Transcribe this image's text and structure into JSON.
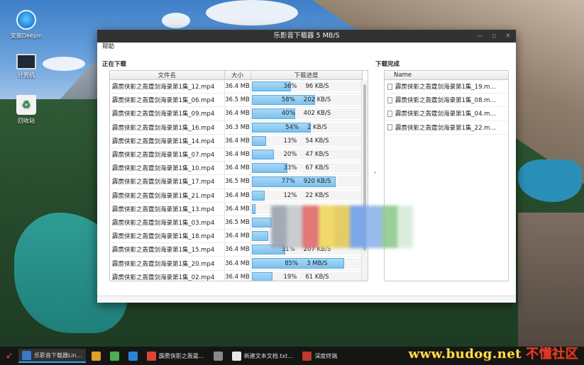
{
  "desktop": {
    "icons": [
      {
        "label": "安装Deepin"
      },
      {
        "label": "计算机"
      },
      {
        "label": "回收站"
      }
    ]
  },
  "window": {
    "title": "乐影音下载器  5 MB/S",
    "menu": {
      "help": "帮助"
    },
    "downloading": {
      "title": "正在下载",
      "columns": [
        "文件名",
        "大小",
        "下载进度"
      ],
      "rows": [
        {
          "name": "霹雳侠影之轰霆剑海录第1集_12.mp4",
          "size": "36.4 MB",
          "percent": "36%",
          "speed": "96 KB/S",
          "progress": 0.36
        },
        {
          "name": "霹雳侠影之轰霆剑海录第1集_06.mp4",
          "size": "36.5 MB",
          "percent": "58%",
          "speed": "202 KB/S",
          "progress": 0.58
        },
        {
          "name": "霹雳侠影之轰霆剑海录第1集_09.mp4",
          "size": "36.4 MB",
          "percent": "40%",
          "speed": "402 KB/S",
          "progress": 0.4
        },
        {
          "name": "霹雳侠影之轰霆剑海录第1集_16.mp4",
          "size": "36.3 MB",
          "percent": "54%",
          "speed": "2 KB/S",
          "progress": 0.54
        },
        {
          "name": "霹雳侠影之轰霆剑海录第1集_14.mp4",
          "size": "36.4 MB",
          "percent": "13%",
          "speed": "54 KB/S",
          "progress": 0.13
        },
        {
          "name": "霹雳侠影之轰霆剑海录第1集_07.mp4",
          "size": "36.4 MB",
          "percent": "20%",
          "speed": "47 KB/S",
          "progress": 0.2
        },
        {
          "name": "霹雳侠影之轰霆剑海录第1集_10.mp4",
          "size": "36.4 MB",
          "percent": "33%",
          "speed": "67 KB/S",
          "progress": 0.33
        },
        {
          "name": "霹雳侠影之轰霆剑海录第1集_17.mp4",
          "size": "36.5 MB",
          "percent": "77%",
          "speed": "920 KB/S",
          "progress": 0.77
        },
        {
          "name": "霹雳侠影之轰霆剑海录第1集_21.mp4",
          "size": "36.4 MB",
          "percent": "12%",
          "speed": "22 KB/S",
          "progress": 0.12
        },
        {
          "name": "霹雳侠影之轰霆剑海录第1集_13.mp4",
          "size": "36.4 MB",
          "percent": "",
          "speed": "",
          "progress": 0.03
        },
        {
          "name": "霹雳侠影之轰霆剑海录第1集_03.mp4",
          "size": "36.5 MB",
          "percent": "",
          "speed": "",
          "progress": 0.18
        },
        {
          "name": "霹雳侠影之轰霆剑海录第1集_18.mp4",
          "size": "36.4 MB",
          "percent": "",
          "speed": "",
          "progress": 0.15
        },
        {
          "name": "霹雳侠影之轰霆剑海录第1集_15.mp4",
          "size": "36.4 MB",
          "percent": "31%",
          "speed": "207 KB/S",
          "progress": 0.31
        },
        {
          "name": "霹雳侠影之轰霆剑海录第1集_20.mp4",
          "size": "36.4 MB",
          "percent": "85%",
          "speed": "3 MB/S",
          "progress": 0.85
        },
        {
          "name": "霹雳侠影之轰霆剑海录第1集_02.mp4",
          "size": "36.4 MB",
          "percent": "19%",
          "speed": "61 KB/S",
          "progress": 0.19
        }
      ]
    },
    "completed": {
      "title": "下载完成",
      "column": "Name",
      "items": [
        "霹雳侠影之轰霆剑海录第1集_19.m…",
        "霹雳侠影之轰霆剑海录第1集_08.m…",
        "霹雳侠影之轰霆剑海录第1集_04.m…",
        "霹雳侠影之轰霆剑海录第1集_22.m…"
      ]
    }
  },
  "taskbar": {
    "items": [
      {
        "label": "乐影音下载器Lin…",
        "icon": "downloader-icon",
        "color": "#3a78c9"
      },
      {
        "label": "",
        "icon": "store-icon",
        "color": "#e0a02a"
      },
      {
        "label": "",
        "icon": "files-icon",
        "color": "#4caf50"
      },
      {
        "label": "",
        "icon": "media-icon",
        "color": "#2a84d6"
      },
      {
        "label": "霹雳侠影之轰霆…",
        "icon": "chrome-icon",
        "color": "#db4437"
      },
      {
        "label": "",
        "icon": "settings-icon",
        "color": "#888888"
      },
      {
        "label": "新建文本文档.txt…",
        "icon": "text-editor-icon",
        "color": "#e8e8e8"
      },
      {
        "label": "深度终端",
        "icon": "terminal-icon",
        "color": "#c0392b"
      }
    ]
  },
  "watermark": {
    "latin": "www.budog.net",
    "cn": "不懂社区"
  }
}
